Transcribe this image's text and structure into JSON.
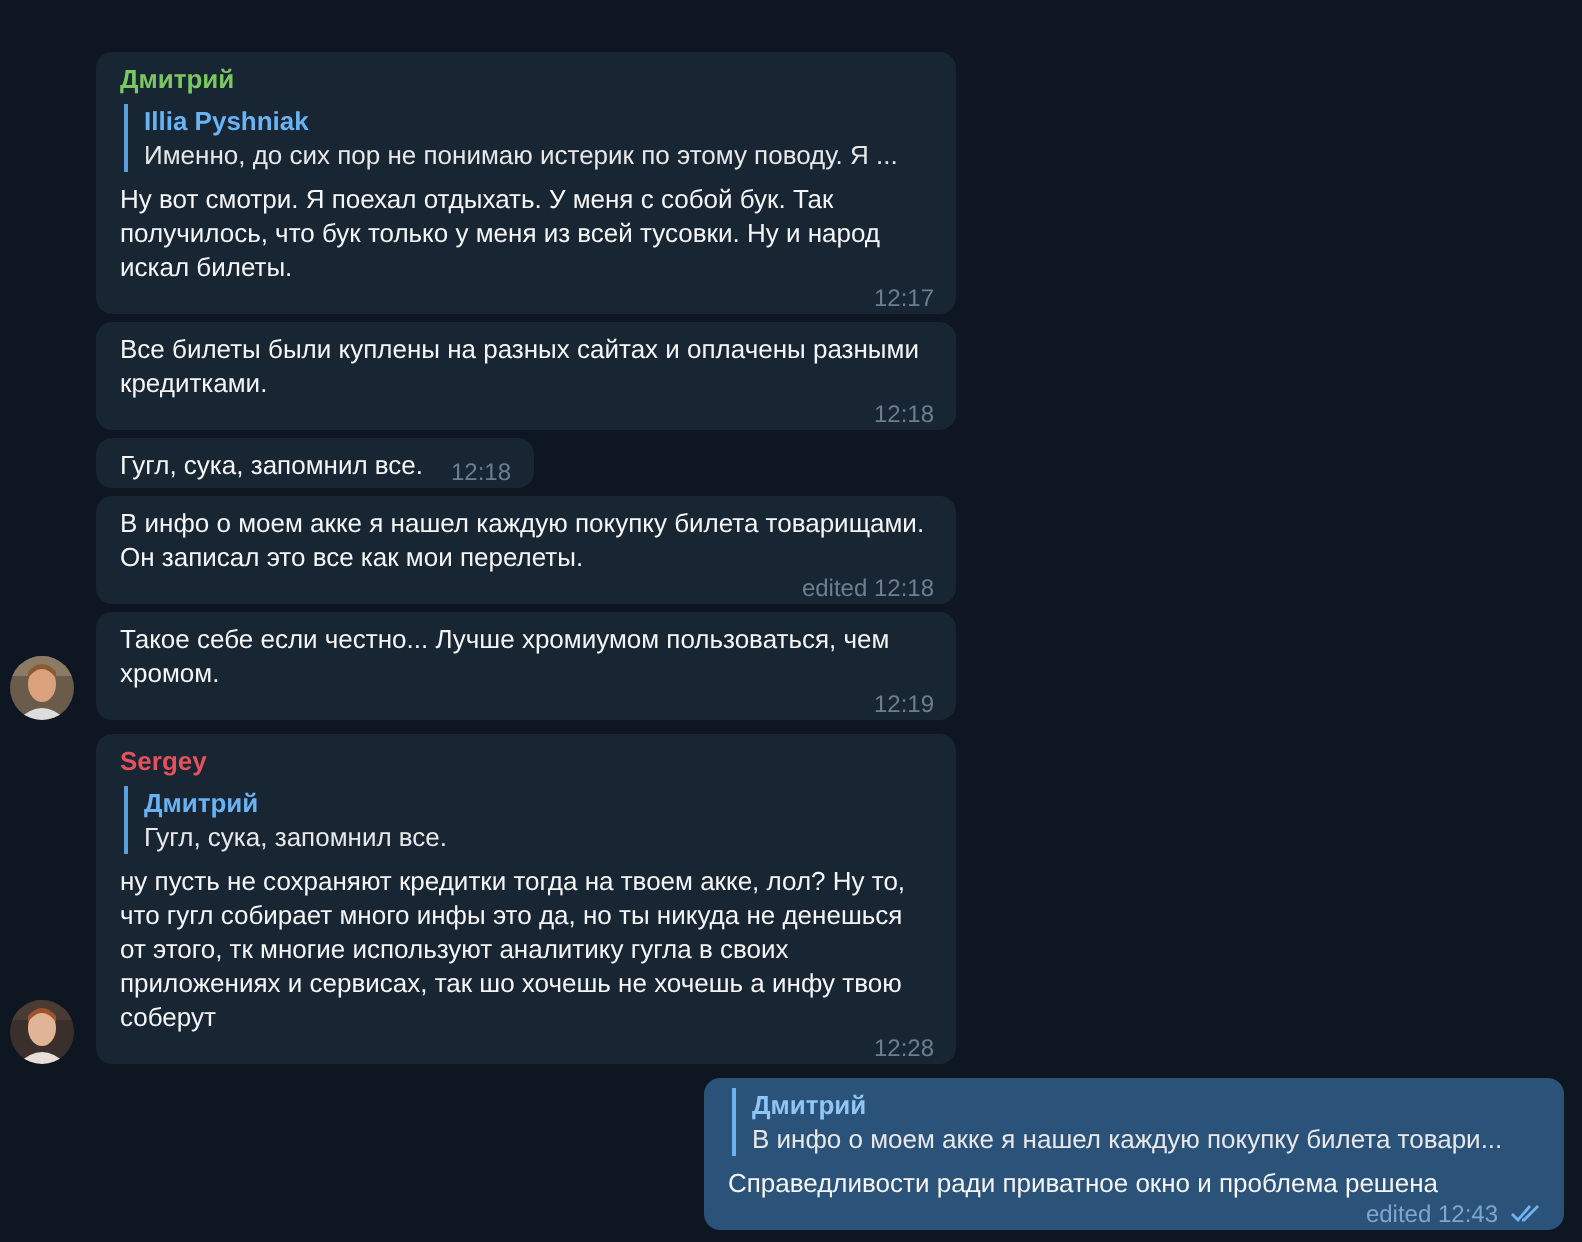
{
  "groups": [
    {
      "kind": "incoming",
      "messages": [
        {
          "sender": {
            "name": "Дмитрий",
            "color": "#7bc862"
          },
          "reply": {
            "author": "Illia Pyshniak",
            "text": "Именно, до сих пор не понимаю истерик по этому поводу. Я ..."
          },
          "text": "Ну вот смотри. Я поехал отдыхать. У меня с собой бук. Так получилось, что бук только у меня из всей тусовки. Ну и народ искал билеты.",
          "meta": "12:17"
        },
        {
          "text": "Все билеты были куплены на разных сайтах и оплачены разными кредитками.",
          "meta": "12:18"
        },
        {
          "text": "Гугл, сука, запомнил все.",
          "meta": "12:18"
        },
        {
          "text": "В инфо о моем акке я нашел каждую покупку билета товарищами. Он записал это все как мои перелеты.",
          "meta": "edited 12:18"
        },
        {
          "text": "Такое себе если честно... Лучше хромиумом пользоваться, чем хромом.",
          "meta": "12:19"
        }
      ]
    },
    {
      "kind": "incoming",
      "messages": [
        {
          "sender": {
            "name": "Sergey",
            "color": "#e5525c"
          },
          "reply": {
            "author": "Дмитрий",
            "text": "Гугл, сука, запомнил все."
          },
          "text": "ну пусть не сохраняют кредитки тогда на твоем акке, лол? Ну то, что гугл собирает много инфы это да, но ты никуда не денешься от этого, тк многие используют аналитику гугла в своих приложениях и сервисах, так шо хочешь не хочешь а инфу твою соберут",
          "meta": "12:28"
        }
      ]
    },
    {
      "kind": "outgoing",
      "messages": [
        {
          "reply": {
            "author": "Дмитрий",
            "text": "В инфо о моем акке я нашел каждую покупку билета товари..."
          },
          "text": "Справедливости ради приватное окно и проблема решена",
          "meta": "edited 12:43",
          "read": true
        }
      ]
    }
  ]
}
